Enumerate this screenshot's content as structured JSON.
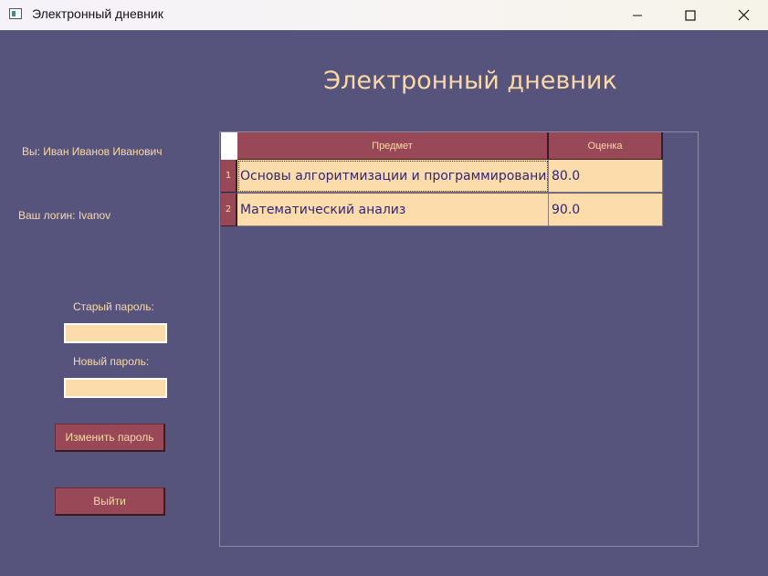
{
  "window": {
    "title": "Электронный дневник",
    "icons": [
      "app-icon",
      "minimize-icon",
      "maximize-icon",
      "close-icon"
    ]
  },
  "header": {
    "title": "Электронный дневник"
  },
  "user": {
    "fio_text": "Вы: Иван Иванов Иванович",
    "login_text": "Ваш логин: Ivanov"
  },
  "password_form": {
    "old_label": "Старый пароль:",
    "old_value": "",
    "new_label": "Новый пароль:",
    "new_value": "",
    "change_button": "Изменить пароль",
    "exit_button": "Выйти"
  },
  "grades_table": {
    "columns": [
      "Предмет",
      "Оценка"
    ],
    "rows": [
      {
        "num": "1",
        "subject": "Основы алгоритмизации и программирования",
        "grade": "80.0"
      },
      {
        "num": "2",
        "subject": "Математический анализ",
        "grade": "90.0"
      }
    ]
  },
  "colors": {
    "background": "#56547c",
    "accent": "#994857",
    "text_light": "#fbd9a6",
    "cell_bg": "#fddcab",
    "cell_text": "#2f2678"
  }
}
